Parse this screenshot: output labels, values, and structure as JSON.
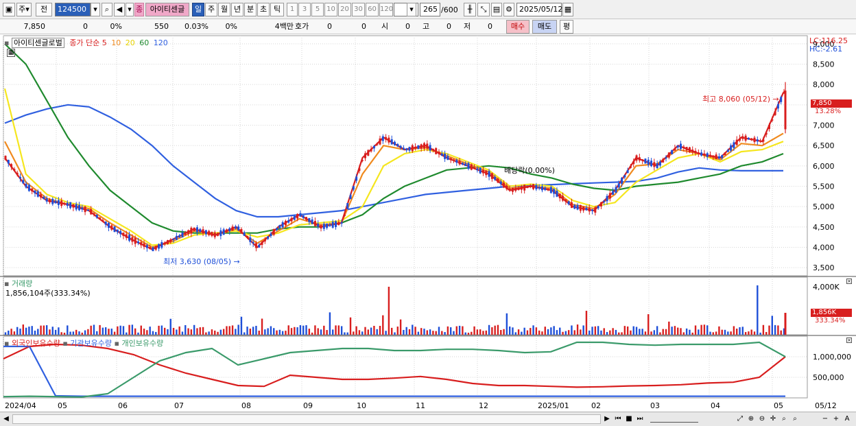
{
  "toolbar": {
    "market": "주",
    "prev": "전",
    "code": "124500",
    "stock_type": "종",
    "stock_name": "아이티센글",
    "periods": [
      "일",
      "주",
      "월",
      "년",
      "분",
      "초",
      "틱"
    ],
    "intervals": [
      "1",
      "3",
      "5",
      "10",
      "20",
      "30",
      "60",
      "120"
    ],
    "count": "265",
    "count_total": "/600",
    "date": "2025/05/12"
  },
  "info": {
    "price": "7,850",
    "change": "0",
    "change_pct": "0%",
    "volume": "550",
    "volume_pct": "0.03%",
    "volume_pct2": "0%",
    "unit": "4백만",
    "quote_label": "호가",
    "q1": "0",
    "q2": "0",
    "open_label": "시",
    "open": "0",
    "high_label": "고",
    "high": "0",
    "low_label": "저",
    "low": "0",
    "buy": "매수",
    "sell": "매도",
    "avg": "평"
  },
  "legend": {
    "title": "아이티센글로벌",
    "ma_label": "종가 단순",
    "ma5": "5",
    "ma10": "10",
    "ma20": "20",
    "ma60": "60",
    "ma120": "120"
  },
  "annotations": {
    "high": "최고 8,060 (05/12)",
    "low": "최저 3,630 (08/05)",
    "ex_rights": "배당락(0.00%)",
    "lc": "LC:116.25",
    "hc": "HC:-2.61",
    "current_price": "7,850",
    "current_pct": "13.28%"
  },
  "volume_panel": {
    "title": "거래량",
    "value": "1,856,104주(333.34%)",
    "current": "1,856K",
    "current_pct": "333.34%"
  },
  "holdings_panel": {
    "foreign": "외국인보유수량",
    "institution": "기관보유수량",
    "individual": "개인보유수량"
  },
  "colors": {
    "up": "#d81e1e",
    "down": "#1e4fd8",
    "ma5": "#d81e1e",
    "ma10": "#f08a1e",
    "ma20": "#f5e61e",
    "ma60": "#1f8a2e",
    "ma120": "#3060e0",
    "foreign": "#d81e1e",
    "institution": "#3060e0",
    "individual": "#3a9a6a"
  },
  "chart_data": [
    {
      "type": "candlestick",
      "title": "아이티센글로벌",
      "ylim": [
        3300,
        9200
      ],
      "y_ticks": [
        3500,
        4000,
        4500,
        5000,
        5500,
        6000,
        6500,
        7000,
        7500,
        8000,
        8500,
        9000
      ],
      "x_ticks": [
        "2024/04",
        "05",
        "06",
        "07",
        "08",
        "09",
        "10",
        "11",
        "12",
        "2025/01",
        "02",
        "03",
        "04",
        "05"
      ],
      "series": [
        {
          "name": "5",
          "values": [
            6200,
            5500,
            5150,
            5050,
            4900,
            4500,
            4200,
            3950,
            4200,
            4450,
            4300,
            4500,
            4000,
            4500,
            4800,
            4500,
            4600,
            6200,
            6700,
            6400,
            6500,
            6200,
            6000,
            5800,
            5400,
            5500,
            5400,
            5000,
            4900,
            5400,
            6200,
            6000,
            6500,
            6300,
            6200,
            6700,
            6600,
            7800
          ]
        },
        {
          "name": "10",
          "values": [
            6600,
            5600,
            5200,
            5050,
            4950,
            4600,
            4300,
            4000,
            4150,
            4400,
            4300,
            4450,
            4100,
            4400,
            4700,
            4550,
            4600,
            5800,
            6500,
            6400,
            6450,
            6250,
            6050,
            5850,
            5450,
            5500,
            5450,
            5050,
            4950,
            5300,
            6000,
            6050,
            6400,
            6300,
            6150,
            6550,
            6500,
            6800
          ]
        },
        {
          "name": "20",
          "values": [
            7900,
            5800,
            5300,
            5100,
            5000,
            4700,
            4400,
            4050,
            4100,
            4300,
            4350,
            4400,
            4250,
            4350,
            4550,
            4600,
            4650,
            5000,
            6000,
            6300,
            6400,
            6300,
            6100,
            5900,
            5500,
            5550,
            5500,
            5150,
            5000,
            5100,
            5600,
            5900,
            6200,
            6300,
            6100,
            6350,
            6400,
            6600
          ]
        },
        {
          "name": "60",
          "values": [
            9000,
            8500,
            7600,
            6700,
            6000,
            5400,
            5000,
            4600,
            4400,
            4350,
            4350,
            4350,
            4350,
            4450,
            4500,
            4500,
            4600,
            4800,
            5200,
            5500,
            5700,
            5900,
            5950,
            6000,
            5950,
            5800,
            5700,
            5550,
            5450,
            5400,
            5500,
            5550,
            5600,
            5700,
            5800,
            6000,
            6100,
            6300
          ]
        },
        {
          "name": "120",
          "values": [
            7050,
            7250,
            7400,
            7500,
            7450,
            7200,
            6900,
            6500,
            6000,
            5600,
            5200,
            4900,
            4750,
            4750,
            4800,
            4850,
            4900,
            5000,
            5100,
            5200,
            5300,
            5350,
            5400,
            5450,
            5500,
            5520,
            5540,
            5560,
            5580,
            5600,
            5620,
            5700,
            5850,
            5950,
            5900,
            5880,
            5880,
            5880
          ]
        }
      ],
      "high": 8060,
      "low": 3630,
      "last": 7850
    },
    {
      "type": "bar",
      "title": "거래량",
      "y_ticks": [
        "4,000K"
      ],
      "last": 1856104
    },
    {
      "type": "line",
      "title": "외국인보유수량 / 기관보유수량 / 개인보유수량",
      "y_ticks": [
        500000,
        1000000
      ],
      "series": [
        {
          "name": "외국인보유수량",
          "values": [
            950000,
            1250000,
            1300000,
            1280000,
            1200000,
            1050000,
            800000,
            600000,
            450000,
            300000,
            280000,
            550000,
            500000,
            450000,
            450000,
            480000,
            520000,
            450000,
            350000,
            300000,
            300000,
            280000,
            260000,
            270000,
            290000,
            300000,
            320000,
            360000,
            380000,
            500000,
            1000000
          ]
        },
        {
          "name": "기관보유수량",
          "values": [
            1250000,
            1250000,
            50000,
            40000,
            40000,
            40000,
            40000,
            40000,
            40000,
            40000,
            40000,
            40000,
            40000,
            40000,
            40000,
            40000,
            40000,
            40000,
            40000,
            40000,
            40000,
            40000,
            40000,
            40000,
            40000,
            40000,
            40000,
            40000,
            40000,
            40000,
            40000
          ]
        },
        {
          "name": "개인보유수량",
          "values": [
            30000,
            40000,
            30000,
            20000,
            100000,
            500000,
            900000,
            1100000,
            1200000,
            800000,
            950000,
            1100000,
            1150000,
            1200000,
            1200000,
            1150000,
            1150000,
            1180000,
            1180000,
            1150000,
            1100000,
            1120000,
            1350000,
            1350000,
            1300000,
            1280000,
            1300000,
            1300000,
            1300000,
            1350000,
            1000000
          ]
        }
      ]
    }
  ],
  "bottom": {
    "date_label": "05/12"
  }
}
